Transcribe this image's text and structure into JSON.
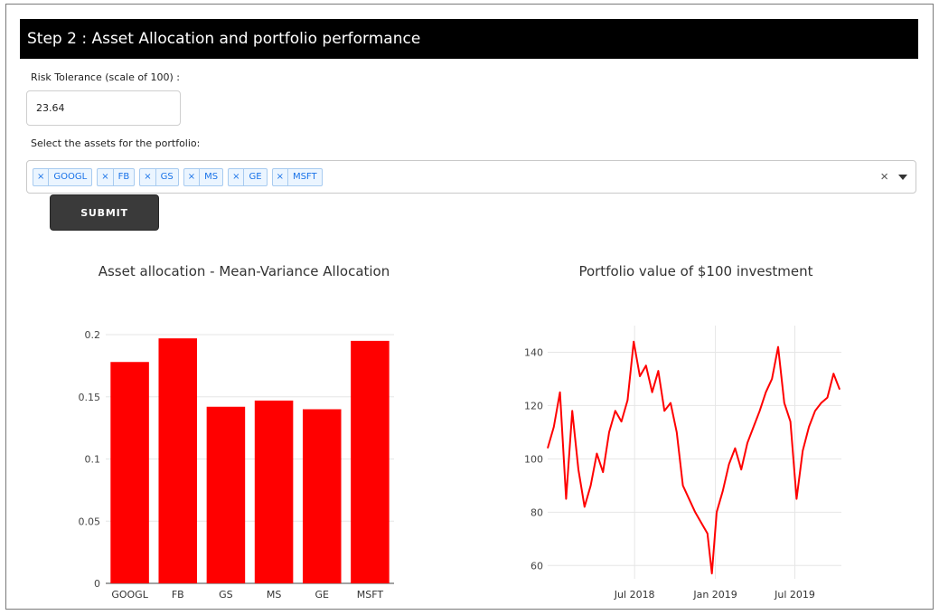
{
  "header": {
    "title": "Step 2 : Asset Allocation and portfolio performance"
  },
  "risk": {
    "label": "Risk Tolerance (scale of 100) :",
    "value": "23.64"
  },
  "assets": {
    "label": "Select the assets for the portfolio:",
    "remove_symbol": "×",
    "selected": [
      "GOOGL",
      "FB",
      "GS",
      "MS",
      "GE",
      "MSFT"
    ],
    "clear_symbol": "×"
  },
  "submit": {
    "label": "SUBMIT"
  },
  "colors": {
    "bar": "#ff0000",
    "line": "#ff0000",
    "header_bg": "#000000",
    "tag_text": "#1a73e8",
    "button_bg": "#3a3a3a"
  },
  "chart_data": [
    {
      "type": "bar",
      "title": "Asset allocation - Mean-Variance Allocation",
      "categories": [
        "GOOGL",
        "FB",
        "GS",
        "MS",
        "GE",
        "MSFT"
      ],
      "values": [
        0.178,
        0.197,
        0.142,
        0.147,
        0.14,
        0.195
      ],
      "ylim": [
        0,
        0.2
      ],
      "yticks": [
        0,
        0.05,
        0.1,
        0.15,
        0.2
      ],
      "ytick_labels": [
        "0",
        "0.05",
        "0.1",
        "0.15",
        "0.2"
      ],
      "grid": true
    },
    {
      "type": "line",
      "title": "Portfolio value of $100 investment",
      "ylim": [
        55,
        150
      ],
      "yticks": [
        60,
        80,
        100,
        120,
        140
      ],
      "ytick_labels": [
        "60",
        "80",
        "100",
        "120",
        "140"
      ],
      "xlim": [
        "2017-12-15",
        "2019-10-15"
      ],
      "xticks": [
        "2018-07-01",
        "2019-01-01",
        "2019-07-01"
      ],
      "xtick_labels": [
        "Jul 2018",
        "Jan 2019",
        "Jul 2019"
      ],
      "grid": true,
      "series": [
        {
          "x": [
            "2017-12-15",
            "2017-12-29",
            "2018-01-12",
            "2018-01-26",
            "2018-02-09",
            "2018-02-23",
            "2018-03-09",
            "2018-03-23",
            "2018-04-06",
            "2018-04-20",
            "2018-05-04",
            "2018-05-18",
            "2018-06-01",
            "2018-06-15",
            "2018-06-29",
            "2018-07-13",
            "2018-07-27",
            "2018-08-10",
            "2018-08-24",
            "2018-09-07",
            "2018-09-21",
            "2018-10-05",
            "2018-10-19",
            "2018-11-02",
            "2018-11-16",
            "2018-11-30",
            "2018-12-14",
            "2018-12-24",
            "2019-01-04",
            "2019-01-18",
            "2019-02-01",
            "2019-02-15",
            "2019-03-01",
            "2019-03-15",
            "2019-03-29",
            "2019-04-12",
            "2019-04-26",
            "2019-05-10",
            "2019-05-24",
            "2019-06-07",
            "2019-06-21",
            "2019-07-05",
            "2019-07-19",
            "2019-08-02",
            "2019-08-16",
            "2019-08-30",
            "2019-09-13",
            "2019-09-27",
            "2019-10-11"
          ],
          "values": [
            104,
            112,
            125,
            85,
            118,
            96,
            82,
            90,
            102,
            95,
            110,
            118,
            114,
            122,
            144,
            131,
            135,
            125,
            133,
            118,
            121,
            110,
            90,
            85,
            80,
            76,
            72,
            57,
            80,
            88,
            98,
            104,
            96,
            106,
            112,
            118,
            125,
            130,
            142,
            121,
            114,
            85,
            103,
            112,
            118,
            121,
            123,
            132,
            126
          ]
        }
      ]
    }
  ]
}
